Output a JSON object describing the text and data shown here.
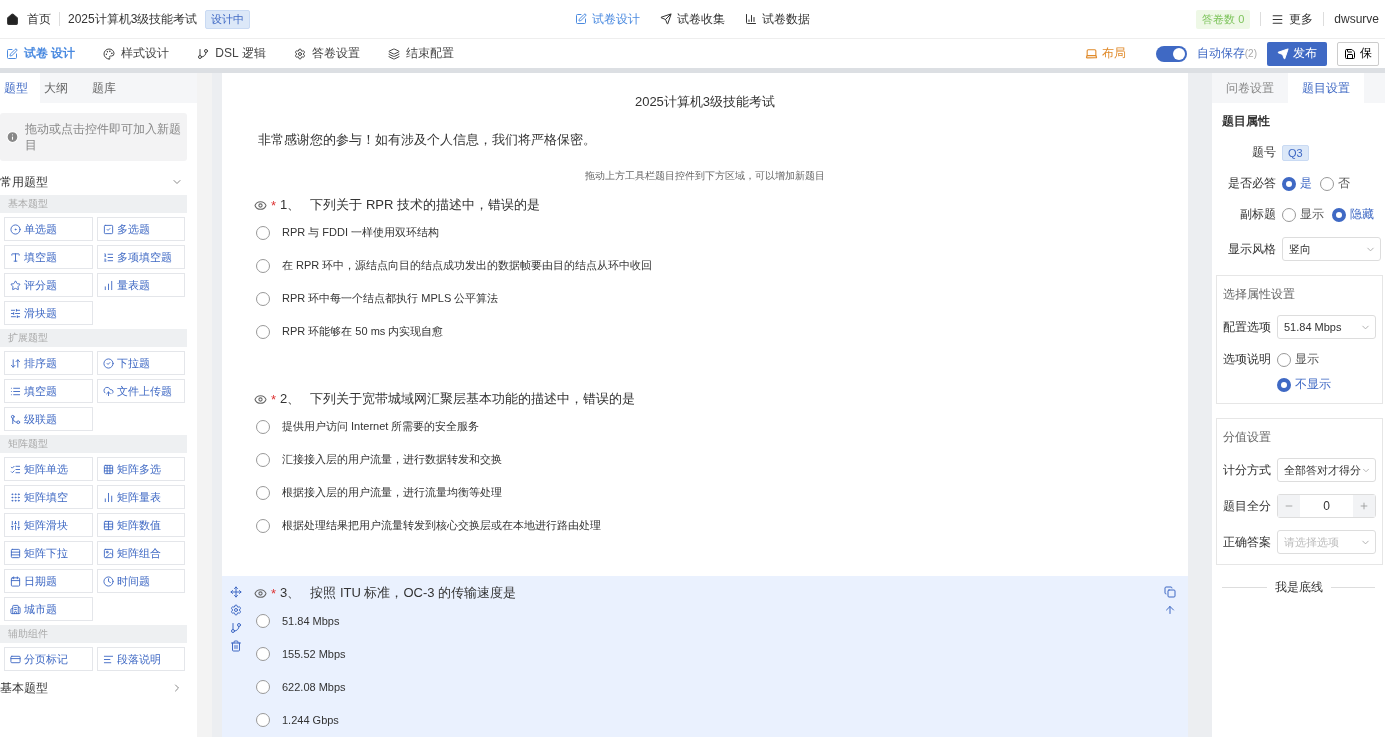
{
  "topbar": {
    "home": "首页",
    "title": "2025计算机3级技能考试",
    "status_tag": "设计中",
    "nav": [
      {
        "label": "试卷设计",
        "selected": true
      },
      {
        "label": "试卷收集",
        "selected": false
      },
      {
        "label": "试卷数据",
        "selected": false
      }
    ],
    "answer_count": {
      "label": "答卷数",
      "value": "0"
    },
    "more": "更多",
    "user": "dwsurve"
  },
  "toolbar": {
    "tabs": [
      {
        "label": "试卷 设计",
        "selected": true
      },
      {
        "label": "样式设计",
        "selected": false
      },
      {
        "label": "DSL 逻辑",
        "selected": false
      },
      {
        "label": "答卷设置",
        "selected": false
      },
      {
        "label": "结束配置",
        "selected": false
      }
    ],
    "layout": "布局",
    "autosave": {
      "label": "自动保存",
      "count": "(2)",
      "on": true
    },
    "publish": "发布",
    "save": "保"
  },
  "left_panel": {
    "tabs": [
      {
        "label": "题型",
        "selected": true
      },
      {
        "label": "大纲",
        "selected": false
      },
      {
        "label": "题库",
        "selected": false
      }
    ],
    "hint": "拖动或点击控件即可加入新题目",
    "sections": [
      {
        "title": "常用题型",
        "expanded": true,
        "groups": [
          {
            "title": "基本题型",
            "items": [
              "单选题",
              "多选题",
              "填空题",
              "多项填空题",
              "评分题",
              "量表题",
              "滑块题"
            ]
          },
          {
            "title": "扩展题型",
            "items": [
              "排序题",
              "下拉题",
              "填空题",
              "文件上传题",
              "级联题"
            ]
          },
          {
            "title": "矩阵题型",
            "items": [
              "矩阵单选",
              "矩阵多选",
              "矩阵填空",
              "矩阵量表",
              "矩阵滑块",
              "矩阵数值",
              "矩阵下拉",
              "矩阵组合",
              "日期题",
              "时间题",
              "城市题"
            ]
          },
          {
            "title": "辅助组件",
            "items": [
              "分页标记",
              "段落说明"
            ]
          }
        ]
      },
      {
        "title": "基本题型",
        "expanded": false
      }
    ]
  },
  "survey": {
    "title": "2025计算机3级技能考试",
    "intro": "非常感谢您的参与！如有涉及个人信息，我们将严格保密。",
    "drop_hint": "拖动上方工具栏题目控件到下方区域，可以增加新题目",
    "questions": [
      {
        "required_mark": "*",
        "number": "1、",
        "text": "下列关于 RPR 技术的描述中，错误的是",
        "selected": false,
        "options": [
          "RPR 与 FDDI 一样使用双环结构",
          "在 RPR 环中，源结点向目的结点成功发出的数据帧要由目的结点从环中收回",
          "RPR 环中每一个结点都执行 MPLS 公平算法",
          "RPR 环能够在 50 ms 内实现自愈"
        ]
      },
      {
        "required_mark": "*",
        "number": "2、",
        "text": "下列关于宽带城域网汇聚层基本功能的描述中，错误的是",
        "selected": false,
        "options": [
          "提供用户访问 Internet 所需要的安全服务",
          "汇接接入层的用户流量，进行数据转发和交换",
          "根据接入层的用户流量，进行流量均衡等处理",
          "根据处理结果把用户流量转发到核心交换层或在本地进行路由处理"
        ]
      },
      {
        "required_mark": "*",
        "number": "3、",
        "text": "按照 ITU 标准，OC-3 的传输速度是",
        "selected": true,
        "options": [
          "51.84 Mbps",
          "155.52 Mbps",
          "622.08 Mbps",
          "1.244 Gbps"
        ]
      }
    ]
  },
  "right_panel": {
    "tabs": [
      {
        "label": "问卷设置",
        "selected": false
      },
      {
        "label": "题目设置",
        "selected": true
      }
    ],
    "section_title": "题目属性",
    "number_label": "题号",
    "number_value": "Q3",
    "required": {
      "label": "是否必答",
      "options": [
        {
          "label": "是",
          "selected": true
        },
        {
          "label": "否",
          "selected": false
        }
      ]
    },
    "subtitle": {
      "label": "副标题",
      "options": [
        {
          "label": "显示",
          "selected": false
        },
        {
          "label": "隐藏",
          "selected": true
        }
      ]
    },
    "style": {
      "label": "显示风格",
      "value": "竖向"
    },
    "choice_card": {
      "title": "选择属性设置",
      "config": {
        "label": "配置选项",
        "value": "51.84 Mbps"
      },
      "note": {
        "label": "选项说明",
        "options": [
          {
            "label": "显示",
            "selected": false
          },
          {
            "label": "不显示",
            "selected": true
          }
        ]
      }
    },
    "score_card": {
      "title": "分值设置",
      "method": {
        "label": "计分方式",
        "value": "全部答对才得分"
      },
      "full": {
        "label": "题目全分",
        "value": "0"
      },
      "answer": {
        "label": "正确答案",
        "placeholder": "请选择选项"
      }
    },
    "footer": "我是底线"
  }
}
